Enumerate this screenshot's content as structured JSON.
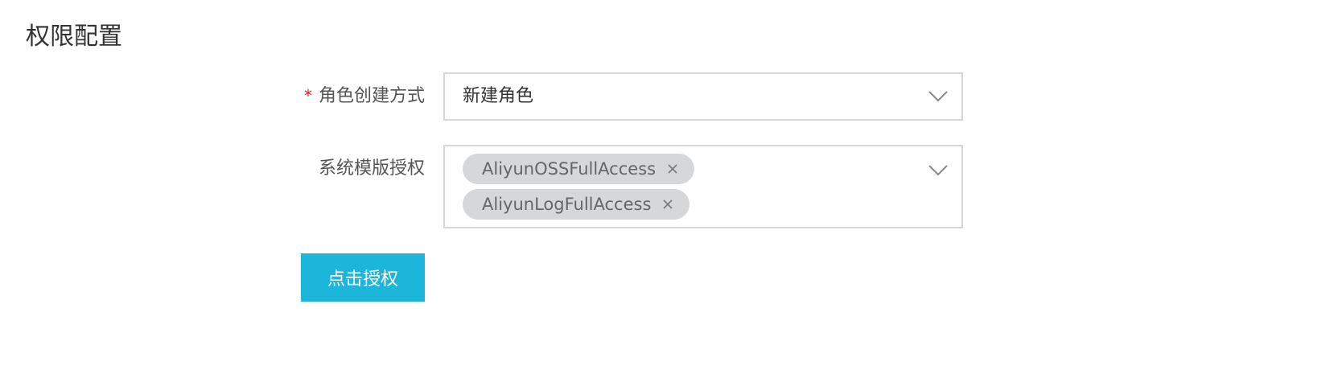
{
  "section": {
    "title": "权限配置"
  },
  "form": {
    "role_method": {
      "required_mark": "*",
      "label": "角色创建方式",
      "selected": "新建角色"
    },
    "system_policies": {
      "label": "系统模版授权",
      "tags": [
        {
          "label": "AliyunOSSFullAccess"
        },
        {
          "label": "AliyunLogFullAccess"
        }
      ]
    },
    "submit_label": "点击授权"
  },
  "colors": {
    "primary_button": "#1cb6db",
    "required_mark": "#e02020",
    "tag_background": "#d6d7d9"
  },
  "icons": {
    "dropdown": "chevron-down-icon",
    "tag_remove": "close-icon"
  }
}
